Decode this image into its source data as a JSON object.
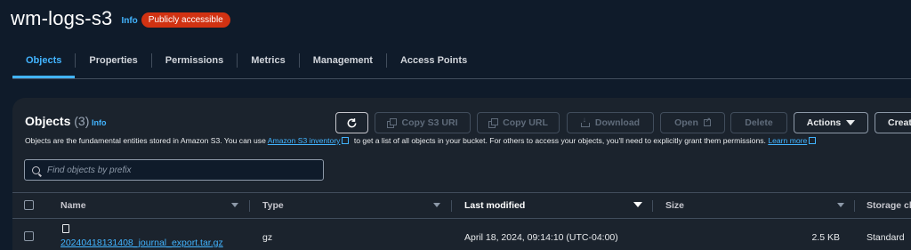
{
  "bucket": {
    "name": "wm-logs-s3",
    "info": "Info",
    "badge": "Publicly accessible"
  },
  "tabs": [
    "Objects",
    "Properties",
    "Permissions",
    "Metrics",
    "Management",
    "Access Points"
  ],
  "objects": {
    "title": "Objects",
    "count": "(3)",
    "info": "Info",
    "description_pre": "Objects are the fundamental entities stored in Amazon S3. You can use ",
    "inventory_link": "Amazon S3 inventory",
    "description_mid": " to get a list of all objects in your bucket. For others to access your objects, you'll need to explicitly grant them permissions. ",
    "learn_more": "Learn more"
  },
  "toolbar": {
    "copy_uri": "Copy S3 URI",
    "copy_url": "Copy URL",
    "download": "Download",
    "open": "Open",
    "delete": "Delete",
    "actions": "Actions",
    "create": "Creat"
  },
  "search": {
    "placeholder": "Find objects by prefix"
  },
  "table": {
    "columns": [
      "Name",
      "Type",
      "Last modified",
      "Size",
      "Storage cl"
    ],
    "sorted_column": "Last modified",
    "rows": [
      {
        "name": "20240418131408_journal_export.tar.gz",
        "type": "gz",
        "last_modified": "April 18, 2024, 09:14:10 (UTC-04:00)",
        "size": "2.5 KB",
        "storage_class": "Standard"
      }
    ]
  },
  "colors": {
    "background": "#0f1b2a",
    "panel": "#1b232d",
    "accent": "#42b4ff",
    "badge": "#d13212"
  }
}
